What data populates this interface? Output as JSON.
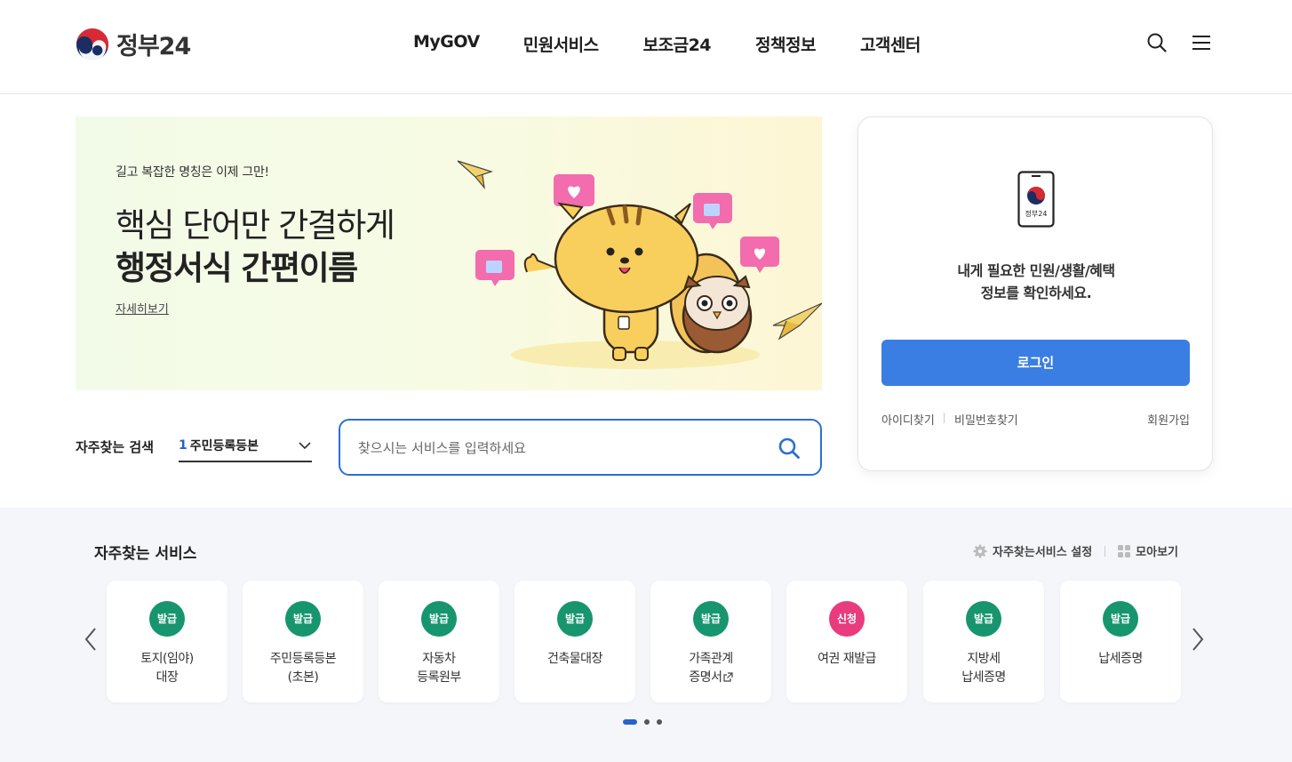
{
  "brand": {
    "name": "정부24"
  },
  "nav": {
    "items": [
      "MyGOV",
      "민원서비스",
      "보조금24",
      "정책정보",
      "고객센터"
    ]
  },
  "header_icons": [
    "search-icon",
    "menu-icon"
  ],
  "banner": {
    "subtitle": "길고 복잡한 명칭은 이제 그만!",
    "title_line1": "핵심 단어만 간결하게",
    "title_line2": "행정서식 간편이름",
    "more_link": "자세히보기"
  },
  "search": {
    "label": "자주찾는 검색",
    "rank_num": "1",
    "rank_term": "주민등록등본",
    "placeholder": "찾으시는 서비스를 입력하세요"
  },
  "login": {
    "phone_label": "정부24",
    "message_line1": "내게 필요한 민원/생활/혜택",
    "message_line2": "정보를 확인하세요.",
    "button": "로그인",
    "find_id": "아이디찾기",
    "find_pw": "비밀번호찾기",
    "join": "회원가입"
  },
  "frequent": {
    "title": "자주찾는 서비스",
    "settings": "자주찾는서비스 설정",
    "view_all": "모아보기",
    "services": [
      {
        "badge": "발급",
        "color": "green",
        "line1": "토지(임야)",
        "line2": "대장"
      },
      {
        "badge": "발급",
        "color": "green",
        "line1": "주민등록등본",
        "line2": "(초본)"
      },
      {
        "badge": "발급",
        "color": "green",
        "line1": "자동차",
        "line2": "등록원부"
      },
      {
        "badge": "발급",
        "color": "green",
        "line1": "건축물대장",
        "line2": ""
      },
      {
        "badge": "발급",
        "color": "green",
        "line1": "가족관계",
        "line2": "증명서"
      },
      {
        "badge": "신청",
        "color": "pink",
        "line1": "여권 재발급",
        "line2": ""
      },
      {
        "badge": "발급",
        "color": "green",
        "line1": "지방세",
        "line2": "납세증명"
      },
      {
        "badge": "발급",
        "color": "green",
        "line1": "납세증명",
        "line2": ""
      }
    ],
    "pagination": {
      "pages": 3,
      "current": 1
    }
  },
  "colors": {
    "primary": "#3a7ee4",
    "search_border": "#2a6fd6",
    "badge_green": "#17956e",
    "badge_pink": "#e83c7e",
    "section_bg": "#f4f6fa"
  }
}
